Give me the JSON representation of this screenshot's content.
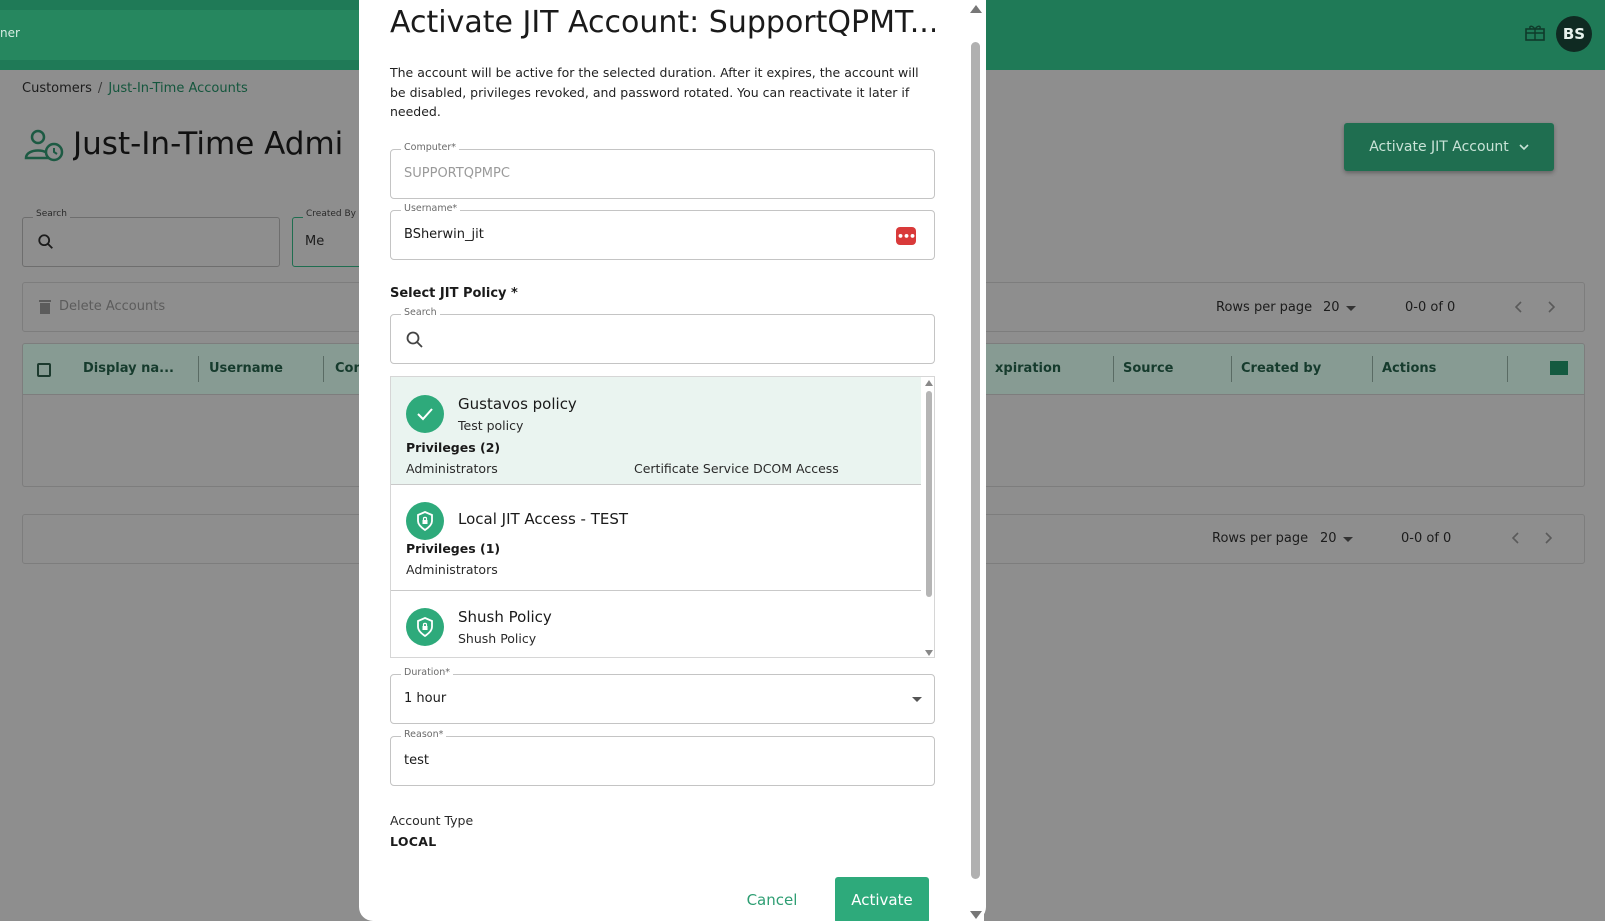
{
  "topbar": {
    "brand_fragment": "ner",
    "user_initials": "BS",
    "accent_color": "#1f7a57"
  },
  "breadcrumb": {
    "items": [
      "Customers",
      "Just-In-Time Accounts"
    ],
    "separator": "/"
  },
  "page": {
    "title": "Just-In-Time Admi",
    "activate_button_label": "Activate JIT Account",
    "filters": {
      "search_label": "Search",
      "created_by_label": "Created By",
      "created_by_value": "Me"
    },
    "toolbar": {
      "delete_label": "Delete Accounts",
      "rows_per_page_label": "Rows per page",
      "rows_per_page_value": "20",
      "range_text": "0-0 of 0"
    },
    "columns": [
      "Display na...",
      "Username",
      "Com",
      "xpiration",
      "Source",
      "Created by",
      "Actions"
    ],
    "footer": {
      "rows_per_page_label": "Rows per page",
      "rows_per_page_value": "20",
      "range_text": "0-0 of 0"
    }
  },
  "modal": {
    "title": "Activate JIT Account: SupportQPMT...",
    "description": "The account will be active for the selected duration. After it expires, the account will be disabled, privileges revoked, and password rotated. You can reactivate it later if needed.",
    "computer": {
      "label": "Computer*",
      "value": "SUPPORTQPMPC"
    },
    "username": {
      "label": "Username*",
      "value": "BSherwin_jit",
      "icon_glyph": "•••"
    },
    "policy_section_label": "Select JIT Policy *",
    "policy_search": {
      "label": "Search",
      "value": ""
    },
    "policies": [
      {
        "name": "Gustavos policy",
        "description": "Test policy",
        "privileges_header": "Privileges (2)",
        "privileges": [
          "Administrators",
          "Certificate Service DCOM Access"
        ],
        "selected": true,
        "icon": "check-icon"
      },
      {
        "name": "Local JIT Access - TEST",
        "description": "",
        "privileges_header": "Privileges (1)",
        "privileges": [
          "Administrators"
        ],
        "selected": false,
        "icon": "shield-lock-icon"
      },
      {
        "name": "Shush Policy",
        "description": "Shush Policy",
        "privileges_header": "",
        "privileges": [],
        "selected": false,
        "icon": "shield-lock-icon"
      }
    ],
    "duration": {
      "label": "Duration*",
      "value": "1 hour"
    },
    "reason": {
      "label": "Reason*",
      "value": "test"
    },
    "account_type": {
      "label": "Account Type",
      "value": "LOCAL"
    },
    "cancel_label": "Cancel",
    "activate_label": "Activate",
    "primary_color": "#2eaa7b"
  }
}
